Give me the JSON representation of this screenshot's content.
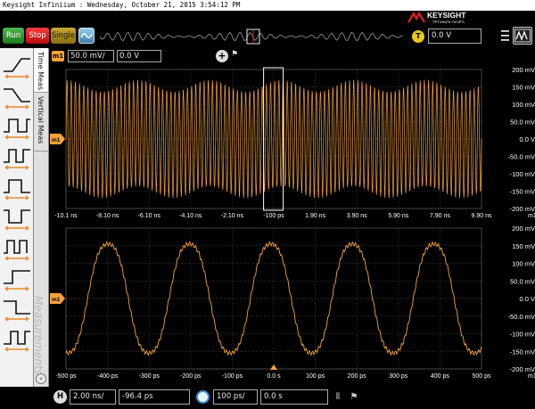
{
  "window": {
    "title": "Keysight Infiniium : Wednesday, October 21, 2015 3:54:12 PM"
  },
  "brand": {
    "name": "KEYSIGHT",
    "sub": "TECHNOLOGIES",
    "color": "#e0201a"
  },
  "toolbar": {
    "run_label": "Run",
    "stop_label": "Stop",
    "single_label": "Single",
    "trigger_badge": "T",
    "trigger_level": "0.0 V"
  },
  "channel": {
    "badge": "m1",
    "scale": "50.0 mV/",
    "offset": "0.0 V",
    "color": "#f5a33a"
  },
  "side_tabs": {
    "time_meas": "Time Meas",
    "vertical_meas": "Vertical Meas",
    "measurements": "Measurements"
  },
  "side_icons": [
    "rise-time-icon",
    "fall-time-icon",
    "period-icon",
    "frequency-icon",
    "positive-width-icon",
    "negative-width-icon",
    "duty-cycle-icon",
    "setup-time-icon",
    "hold-time-icon",
    "tie-icon"
  ],
  "upper_plot": {
    "marker": "m1",
    "y_ticks": [
      "200 mV",
      "150 mV",
      "100 mV",
      "50.0 mV",
      "0.0 V",
      "-50.0 mV",
      "-100 mV",
      "-150 mV",
      "-200 mV"
    ],
    "x_ticks": [
      "-10.1 ns",
      "-8.10 ns",
      "-6.10 ns",
      "-4.10 ns",
      "-2.10 ns",
      "-100 ps",
      "1.90 ns",
      "3.90 ns",
      "5.90 ns",
      "7.90 ns",
      "9.90 ns"
    ],
    "x_unit_tag": "m1",
    "x_range": [
      -10.1,
      9.9
    ],
    "y_range": [
      -200,
      200
    ],
    "carrier_cycles": 100,
    "amplitude_mv": 170
  },
  "lower_plot": {
    "marker": "m1",
    "y_ticks": [
      "200 mV",
      "150 mV",
      "100 mV",
      "50.0 mV",
      "0.0 V",
      "-50.0 mV",
      "-100 mV",
      "-150 mV",
      "-200 mV"
    ],
    "x_ticks": [
      "-500 ps",
      "-400 ps",
      "-300 ps",
      "-200 ps",
      "-100 ps",
      "0.0 s",
      "100 ps",
      "200 ps",
      "300 ps",
      "400 ps",
      "500 ps"
    ],
    "x_unit_tag": "m1",
    "x_range": [
      -500,
      500
    ],
    "y_range": [
      -200,
      200
    ],
    "period_ps": 196,
    "amplitude_mv": 165
  },
  "horizontal": {
    "badge": "H",
    "scale": "2.00 ns/",
    "position": "-96.4 ps",
    "zoom_scale": "100 ps/",
    "zoom_position": "0.0 s"
  },
  "colors": {
    "trace": "#f5a33a",
    "grid": "#5a5a5a",
    "axis_text": "#ffffff",
    "zoom_box": "#ffffff"
  }
}
